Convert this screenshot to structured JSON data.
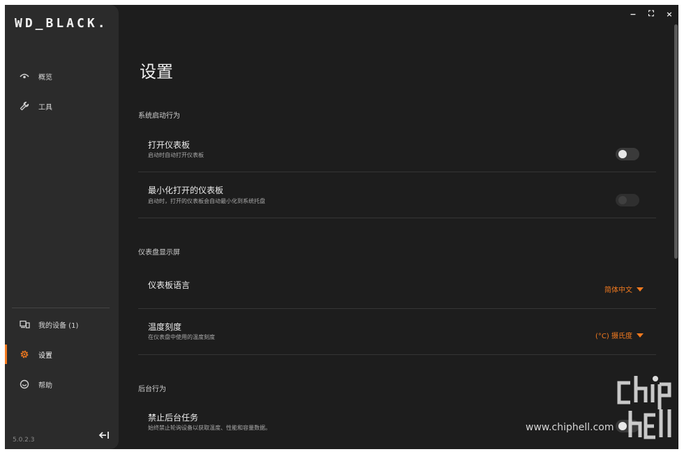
{
  "sidebar": {
    "logo": "WD_BLACK.",
    "nav_top": [
      {
        "label": "概览",
        "icon": "eye-icon"
      },
      {
        "label": "工具",
        "icon": "wrench-icon"
      }
    ],
    "nav_bottom": [
      {
        "label": "我的设备 (1)",
        "icon": "devices-icon"
      },
      {
        "label": "设置",
        "icon": "gear-icon",
        "active": true
      },
      {
        "label": "帮助",
        "icon": "help-icon"
      }
    ],
    "version": "5.0.2.3",
    "collapse_icon": "collapse-left-icon"
  },
  "window_controls": {
    "minimize": "−",
    "maximize": "⛶",
    "close": "×"
  },
  "main": {
    "title": "设置",
    "sections": [
      {
        "title": "系统启动行为",
        "rows": [
          {
            "title": "打开仪表板",
            "desc": "启动时自动打开仪表板",
            "control": "toggle"
          },
          {
            "title": "最小化打开的仪表板",
            "desc": "启动时，打开的仪表板会自动最小化到系统托盘",
            "control": "toggle-disabled"
          }
        ]
      },
      {
        "title": "仪表盘显示屏",
        "rows": [
          {
            "title": "仪表板语言",
            "desc": "",
            "control": "dropdown",
            "value": "简体中文"
          },
          {
            "title": "温度刻度",
            "desc": "在仪表盘中使用的温度刻度",
            "control": "dropdown",
            "value": "(°C) 摄氏度"
          }
        ]
      },
      {
        "title": "后台行为",
        "rows": [
          {
            "title": "禁止后台任务",
            "desc": "始终禁止轮询设备以获取温度、性能和容量数据。",
            "control": "toggle"
          }
        ]
      }
    ]
  },
  "watermark": {
    "text": "www.chiphell.com",
    "logo": "chiphell"
  },
  "colors": {
    "accent": "#f37a1f",
    "background": "#1d1d1d",
    "sidebar": "#2b2b2b"
  }
}
